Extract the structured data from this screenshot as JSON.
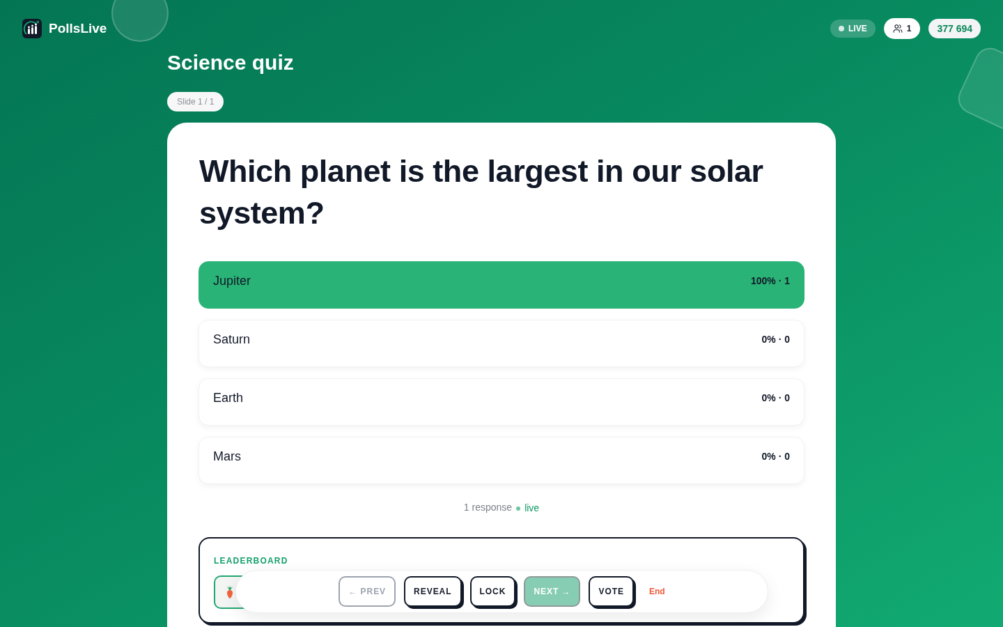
{
  "header": {
    "brand": "PollsLive",
    "live_badge": "LIVE",
    "participants": "1",
    "join_code": "377 694"
  },
  "quiz": {
    "title": "Science quiz",
    "slide_badge": "Slide 1 / 1"
  },
  "question": "Which planet is the largest in our solar system?",
  "options": [
    {
      "label": "Jupiter",
      "result": "100% · 1",
      "highlighted": true
    },
    {
      "label": "Saturn",
      "result": "0% · 0",
      "highlighted": false
    },
    {
      "label": "Earth",
      "result": "0% · 0",
      "highlighted": false
    },
    {
      "label": "Mars",
      "result": "0% · 0",
      "highlighted": false
    }
  ],
  "responses": {
    "count": "1 response",
    "status": "live"
  },
  "leaderboard": {
    "title": "LEADERBOARD",
    "entries": [
      {
        "highlighted": true
      }
    ]
  },
  "controls": [
    {
      "label": "← PREV",
      "kind": "outline",
      "disabled": true
    },
    {
      "label": "REVEAL",
      "kind": "outline",
      "disabled": false
    },
    {
      "label": "LOCK",
      "kind": "outline",
      "disabled": false
    },
    {
      "label": "NEXT →",
      "kind": "primary",
      "disabled": true
    },
    {
      "label": "VOTE",
      "kind": "outline",
      "disabled": false
    },
    {
      "label": "End",
      "kind": "link",
      "disabled": false
    }
  ]
}
